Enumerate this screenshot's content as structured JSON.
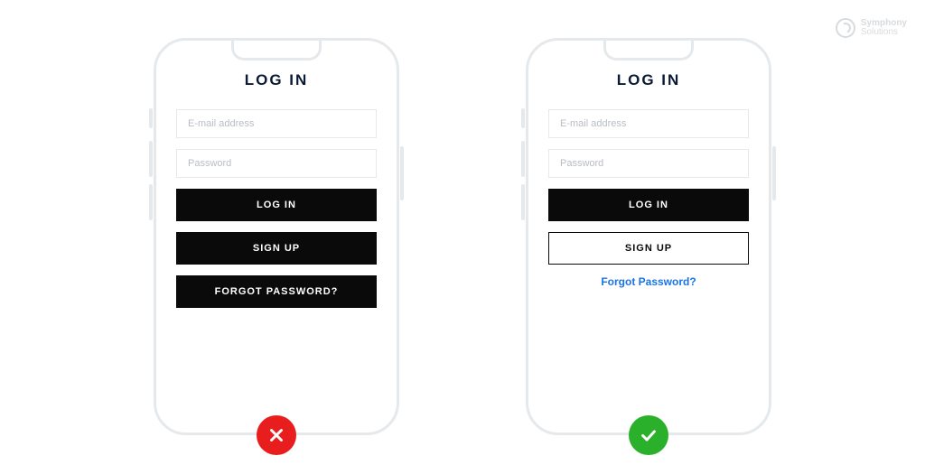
{
  "brand": {
    "line1": "Symphony",
    "line2": "Solutions"
  },
  "bad": {
    "title": "LOG IN",
    "email_placeholder": "E-mail address",
    "password_placeholder": "Password",
    "login_label": "LOG IN",
    "signup_label": "SIGN UP",
    "forgot_label": "FORGOT PASSWORD?",
    "status": "incorrect"
  },
  "good": {
    "title": "LOG IN",
    "email_placeholder": "E-mail address",
    "password_placeholder": "Password",
    "login_label": "LOG IN",
    "signup_label": "SIGN UP",
    "forgot_label": "Forgot Password?",
    "status": "correct"
  },
  "colors": {
    "frame": "#e6e9ec",
    "button_primary_bg": "#0a0a0a",
    "link": "#1a73e8",
    "badge_red": "#e81e1e",
    "badge_green": "#2bb02b"
  }
}
